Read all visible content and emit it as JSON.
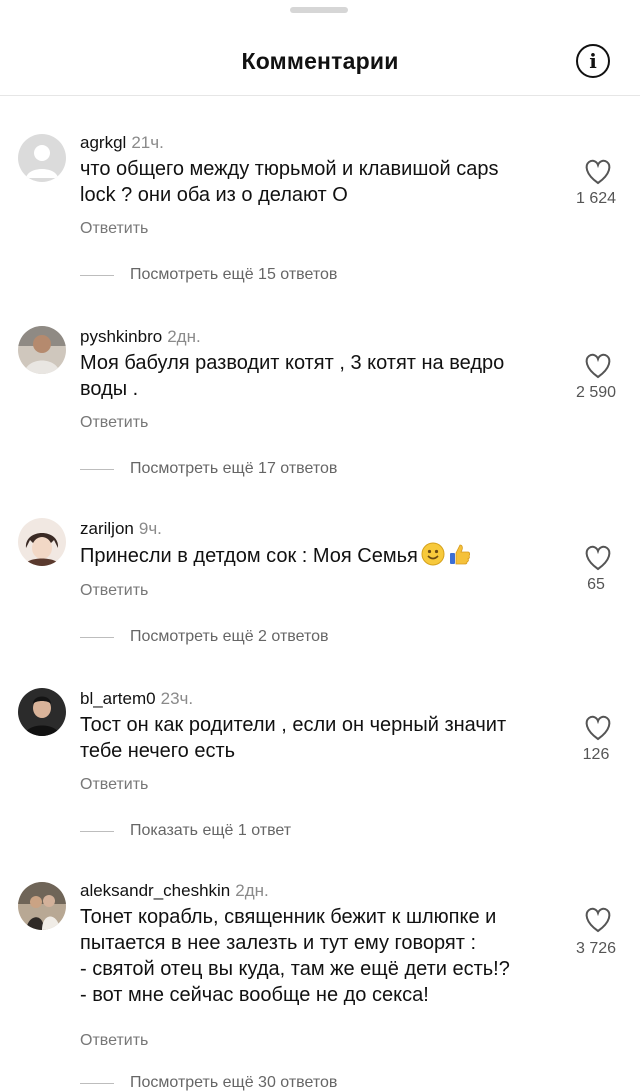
{
  "header": {
    "title": "Комментарии",
    "info_icon": "info-icon"
  },
  "comments": [
    {
      "username": "agrkgl",
      "time": "21ч.",
      "lines": [
        "что общего между тюрьмой и клавишой caps",
        "lock ? они оба из о делают О"
      ],
      "reply": "Ответить",
      "likes": "1 624",
      "view_more": "Посмотреть ещё 15 ответов",
      "avatar": "default-avatar"
    },
    {
      "username": "pyshkinbro",
      "time": "2дн.",
      "lines": [
        "Моя бабуля разводит котят , 3 котят на ведро",
        "воды ."
      ],
      "reply": "Ответить",
      "likes": "2 590",
      "view_more": "Посмотреть ещё 17 ответов",
      "avatar": "photo-avatar"
    },
    {
      "username": "zariljon",
      "time": "9ч.",
      "lines": [
        "Принесли в детдом сок : Моя Семья"
      ],
      "emoji": [
        "smiling-face-emoji",
        "thumbs-up-emoji"
      ],
      "reply": "Ответить",
      "likes": "65",
      "view_more": "Посмотреть ещё 2 ответов",
      "avatar": "anime-avatar"
    },
    {
      "username": "bl_artem0",
      "time": "23ч.",
      "lines": [
        "Тост он как родители , если он черный значит",
        "тебе нечего есть"
      ],
      "reply": "Ответить",
      "likes": "126",
      "view_more": "Показать ещё 1 ответ",
      "avatar": "photo-avatar"
    },
    {
      "username": "aleksandr_cheshkin",
      "time": "2дн.",
      "lines": [
        "Тонет корабль, священник бежит к шлюпке  и",
        "пытается в нее залезть и тут ему говорят :",
        "- святой отец вы куда, там же ещё дети есть!?",
        "- вот мне сейчас вообще не до секса!"
      ],
      "reply": "Ответить",
      "likes": "3 726",
      "view_more": "Посмотреть ещё 30 ответов",
      "avatar": "photo-avatar"
    }
  ]
}
